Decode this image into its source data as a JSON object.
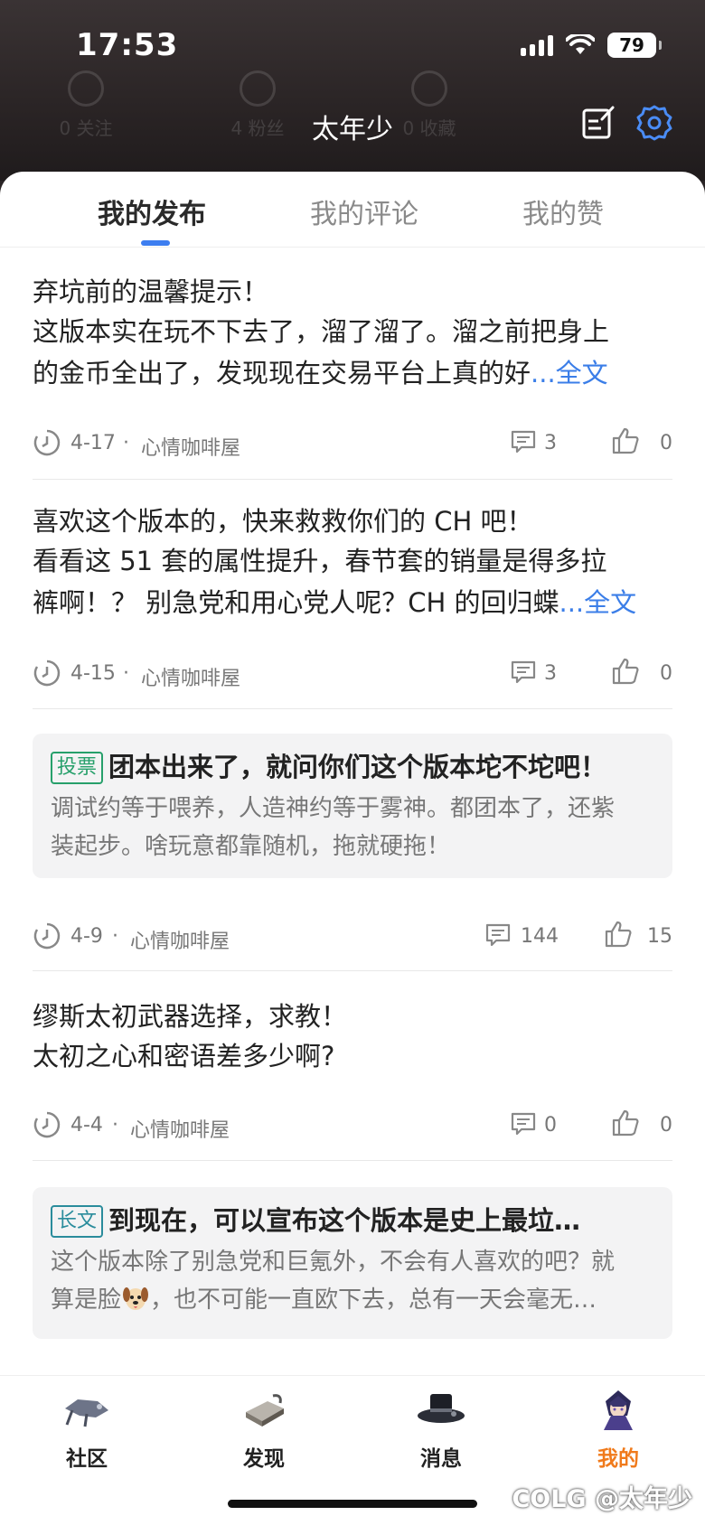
{
  "status_bar": {
    "time": "17:53",
    "battery": "79"
  },
  "header": {
    "title": "太年少",
    "icons": [
      "edit-icon",
      "settings-icon"
    ],
    "background_stats": [
      "0 关注",
      "4 粉丝",
      "0 收藏"
    ]
  },
  "tabs": [
    {
      "label": "我的发布",
      "active": true
    },
    {
      "label": "我的评论",
      "active": false
    },
    {
      "label": "我的赞",
      "active": false
    }
  ],
  "posts": [
    {
      "title": "弃坑前的温馨提示！",
      "body_lines": [
        "这版本实在玩不下去了，溜了溜了。溜之前把身上",
        "的金币全出了，发现现在交易平台上真的好"
      ],
      "more": "...全文",
      "date": "4-17",
      "club": "心情咖啡屋",
      "comments": "3",
      "likes": "0"
    },
    {
      "title": "喜欢这个版本的，快来救救你们的 CH 吧！",
      "body_lines": [
        "看看这 51 套的属性提升，春节套的销量是得多拉",
        "裤啊！？ 别急党和用心党人呢？CH 的回归蝶"
      ],
      "more": "...全文",
      "date": "4-15",
      "club": "心情咖啡屋",
      "comments": "3",
      "likes": "0"
    },
    {
      "tag": "投票",
      "title": "团本出来了，就问你们这个版本坨不坨吧！",
      "body_lines": [
        "调试约等于喂养，人造神约等于雾神。都团本了，还紫",
        "装起步。啥玩意都靠随机，拖就硬拖！"
      ],
      "date": "4-9",
      "club": "心情咖啡屋",
      "comments": "144",
      "likes": "15"
    },
    {
      "title": "缪斯太初武器选择，求教！",
      "body_lines": [
        "太初之心和密语差多少啊?"
      ],
      "date": "4-4",
      "club": "心情咖啡屋",
      "comments": "0",
      "likes": "0"
    },
    {
      "tag": "长文",
      "title": "到现在，可以宣布这个版本是史上最垃…",
      "body_lines": [
        "这个版本除了别急党和巨氪外，不会有人喜欢的吧？就",
        "算是脸",
        "，也不可能一直欧下去，总有一天会毫无…"
      ]
    }
  ],
  "meta_separator": "·",
  "bottom_nav": [
    {
      "label": "社区",
      "icon": "community-icon",
      "active": false
    },
    {
      "label": "发现",
      "icon": "discover-icon",
      "active": false
    },
    {
      "label": "消息",
      "icon": "message-icon",
      "active": false
    },
    {
      "label": "我的",
      "icon": "profile-icon",
      "active": true
    }
  ],
  "watermark": "COLG @太年少",
  "colors": {
    "accent": "#3d7ef0",
    "active_nav": "#f07a1b",
    "vote_tag": "#27a06b",
    "long_tag": "#2a8c9c",
    "link": "#3b7ee8"
  }
}
